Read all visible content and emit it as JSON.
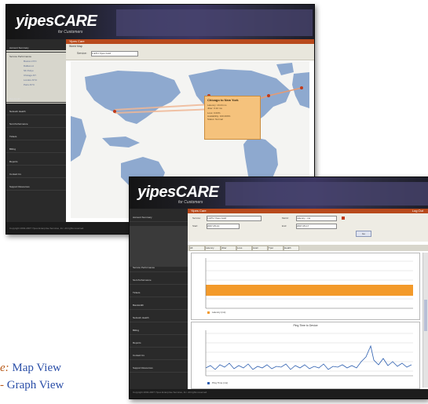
{
  "captions": {
    "map_label": "Map View",
    "graph_label": "Graph View",
    "map_prefix": "e:",
    "graph_prefix": "-"
  },
  "map_window": {
    "logo": "yipes",
    "logo_care": "CARE",
    "logo_sub": "for Customers",
    "topbar_label": "Yipes Care",
    "panel_title": "World Map",
    "filter_label": "Service:",
    "filter_value": "1-ETH  Yipes Gold",
    "sidebar_items": [
      "Account Summary",
      "Service Performance",
      "Bandwidth",
      "Network Health",
      "SLA Performance",
      "Tickets",
      "Billing",
      "Reports",
      "Contact Us",
      "Support Resources"
    ],
    "sidebar_sub": [
      "Boston-NYC",
      "Dallas-LA",
      "SF-Tokyo",
      "Chicago-NY",
      "London-NYC",
      "Paris-NYC"
    ],
    "popup": {
      "title": "Chicago to New York",
      "lines": [
        "Latency: 19.24 ms",
        "Jitter: 0.32 ms",
        "Loss: 0.00%",
        "Availability: 100.000%",
        "Status: Normal"
      ]
    },
    "footer": "Copyright 2002-2007 Yipes Enterprise Services, Inc. All rights reserved."
  },
  "graph_window": {
    "logo": "yipes",
    "logo_care": "CARE",
    "logo_sub": "for Customers",
    "topbar_label": "Yipes Care",
    "header_right": "Log Out",
    "form": {
      "service_label": "Service:",
      "service_value": "1-ETH  Yipes Gold",
      "metric_label": "Metric:",
      "metric_value": "Latency - ms",
      "start_label": "Start:",
      "start_value": "2007-05-10",
      "end_label": "End:",
      "end_value": "2007-05-17",
      "submit_label": "Go"
    },
    "tabs": [
      "All",
      "Latency",
      "Jitter",
      "Loss",
      "Avail",
      "Tput",
      "Health"
    ],
    "graph_title": "Ping Time to Device",
    "legend_upper": "Latency (ms)",
    "legend_lower": "Ping Time (ms)",
    "sidebar_items": [
      "Account Summary",
      "Service Performance",
      "SLA Performance",
      "Tickets",
      "Bandwidth",
      "Network Health",
      "Billing",
      "Reports",
      "Contact Us",
      "Support Resources"
    ],
    "footer": "Copyright 2002-2007 Yipes Enterprise Services, Inc. All rights reserved."
  }
}
